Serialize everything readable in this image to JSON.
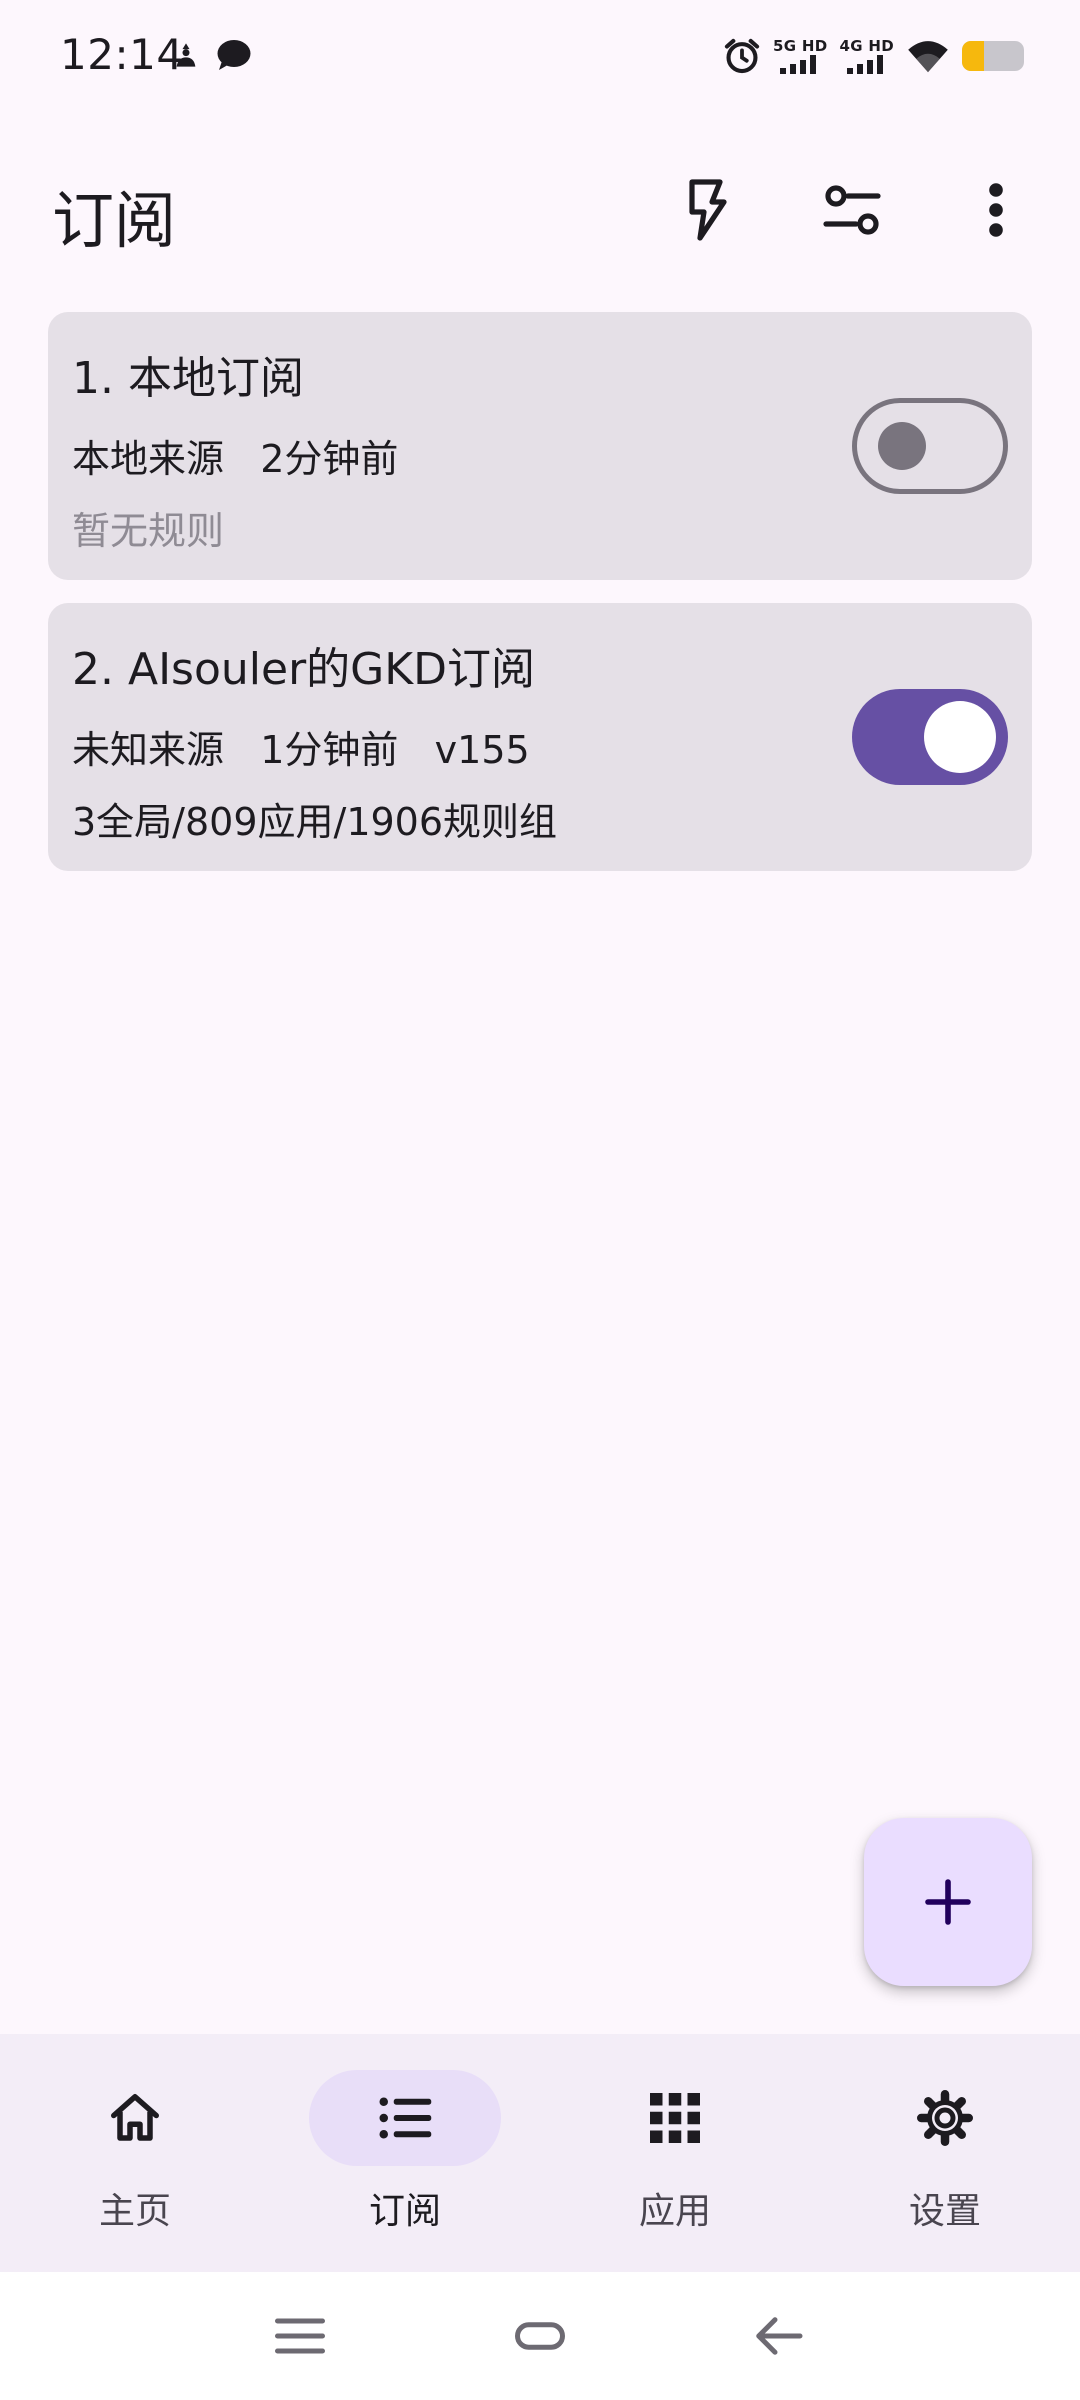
{
  "status_bar": {
    "time": "12:14",
    "net1_label": "5G HD",
    "net2_label": "4G HD",
    "battery_level": 0.35
  },
  "header": {
    "title": "订阅",
    "actions": [
      "flash-icon",
      "tune-icon",
      "more-vert-icon"
    ]
  },
  "subscriptions": [
    {
      "title": "1. 本地订阅",
      "meta": "本地来源   2分钟前",
      "extra": "暂无规则",
      "enabled": false
    },
    {
      "title": "2. AIsouler的GKD订阅",
      "meta": "未知来源   1分钟前   v155",
      "extra": "3全局/809应用/1906规则组",
      "enabled": true
    }
  ],
  "fab": {
    "icon": "plus-icon"
  },
  "bottom_nav": {
    "active": 1,
    "items": [
      {
        "label": "主页",
        "icon": "home-icon"
      },
      {
        "label": "订阅",
        "icon": "list-icon"
      },
      {
        "label": "应用",
        "icon": "apps-grid-icon"
      },
      {
        "label": "设置",
        "icon": "settings-gear-icon"
      }
    ]
  },
  "colors": {
    "background": "#fdf7fd",
    "card": "#e5e0e7",
    "primary": "#6650a4",
    "nav_bar": "#f3edf7",
    "nav_pill": "#e8def8",
    "fab": "#eaddff"
  }
}
